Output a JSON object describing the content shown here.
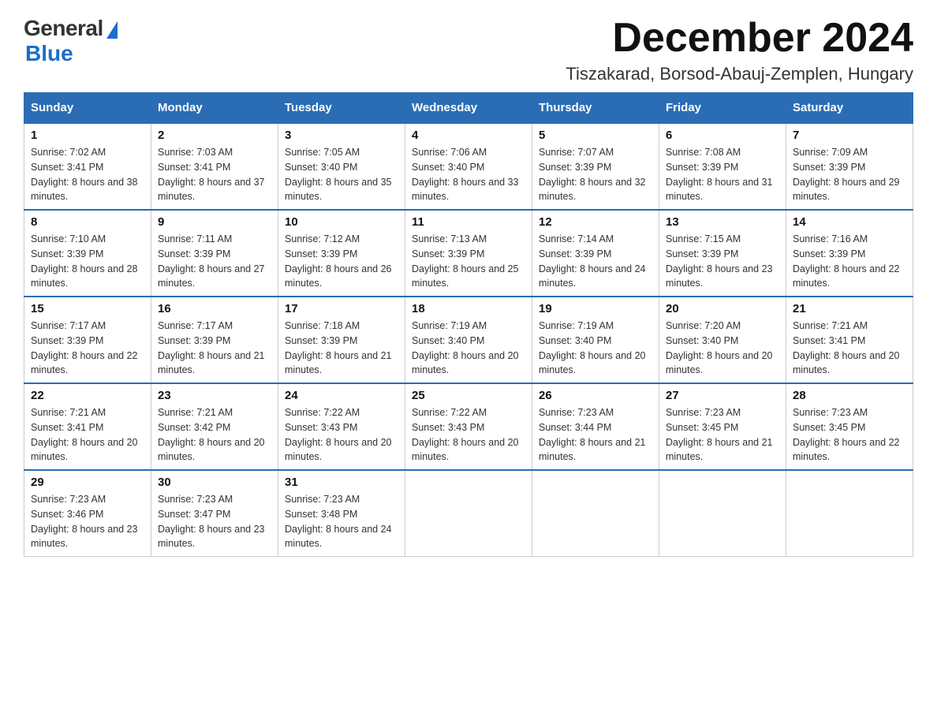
{
  "logo": {
    "general": "General",
    "blue": "Blue",
    "subtitle": "Blue"
  },
  "header": {
    "month_year": "December 2024",
    "location": "Tiszakarad, Borsod-Abauj-Zemplen, Hungary"
  },
  "days_of_week": [
    "Sunday",
    "Monday",
    "Tuesday",
    "Wednesday",
    "Thursday",
    "Friday",
    "Saturday"
  ],
  "weeks": [
    [
      {
        "day": "1",
        "sunrise": "7:02 AM",
        "sunset": "3:41 PM",
        "daylight": "8 hours and 38 minutes."
      },
      {
        "day": "2",
        "sunrise": "7:03 AM",
        "sunset": "3:41 PM",
        "daylight": "8 hours and 37 minutes."
      },
      {
        "day": "3",
        "sunrise": "7:05 AM",
        "sunset": "3:40 PM",
        "daylight": "8 hours and 35 minutes."
      },
      {
        "day": "4",
        "sunrise": "7:06 AM",
        "sunset": "3:40 PM",
        "daylight": "8 hours and 33 minutes."
      },
      {
        "day": "5",
        "sunrise": "7:07 AM",
        "sunset": "3:39 PM",
        "daylight": "8 hours and 32 minutes."
      },
      {
        "day": "6",
        "sunrise": "7:08 AM",
        "sunset": "3:39 PM",
        "daylight": "8 hours and 31 minutes."
      },
      {
        "day": "7",
        "sunrise": "7:09 AM",
        "sunset": "3:39 PM",
        "daylight": "8 hours and 29 minutes."
      }
    ],
    [
      {
        "day": "8",
        "sunrise": "7:10 AM",
        "sunset": "3:39 PM",
        "daylight": "8 hours and 28 minutes."
      },
      {
        "day": "9",
        "sunrise": "7:11 AM",
        "sunset": "3:39 PM",
        "daylight": "8 hours and 27 minutes."
      },
      {
        "day": "10",
        "sunrise": "7:12 AM",
        "sunset": "3:39 PM",
        "daylight": "8 hours and 26 minutes."
      },
      {
        "day": "11",
        "sunrise": "7:13 AM",
        "sunset": "3:39 PM",
        "daylight": "8 hours and 25 minutes."
      },
      {
        "day": "12",
        "sunrise": "7:14 AM",
        "sunset": "3:39 PM",
        "daylight": "8 hours and 24 minutes."
      },
      {
        "day": "13",
        "sunrise": "7:15 AM",
        "sunset": "3:39 PM",
        "daylight": "8 hours and 23 minutes."
      },
      {
        "day": "14",
        "sunrise": "7:16 AM",
        "sunset": "3:39 PM",
        "daylight": "8 hours and 22 minutes."
      }
    ],
    [
      {
        "day": "15",
        "sunrise": "7:17 AM",
        "sunset": "3:39 PM",
        "daylight": "8 hours and 22 minutes."
      },
      {
        "day": "16",
        "sunrise": "7:17 AM",
        "sunset": "3:39 PM",
        "daylight": "8 hours and 21 minutes."
      },
      {
        "day": "17",
        "sunrise": "7:18 AM",
        "sunset": "3:39 PM",
        "daylight": "8 hours and 21 minutes."
      },
      {
        "day": "18",
        "sunrise": "7:19 AM",
        "sunset": "3:40 PM",
        "daylight": "8 hours and 20 minutes."
      },
      {
        "day": "19",
        "sunrise": "7:19 AM",
        "sunset": "3:40 PM",
        "daylight": "8 hours and 20 minutes."
      },
      {
        "day": "20",
        "sunrise": "7:20 AM",
        "sunset": "3:40 PM",
        "daylight": "8 hours and 20 minutes."
      },
      {
        "day": "21",
        "sunrise": "7:21 AM",
        "sunset": "3:41 PM",
        "daylight": "8 hours and 20 minutes."
      }
    ],
    [
      {
        "day": "22",
        "sunrise": "7:21 AM",
        "sunset": "3:41 PM",
        "daylight": "8 hours and 20 minutes."
      },
      {
        "day": "23",
        "sunrise": "7:21 AM",
        "sunset": "3:42 PM",
        "daylight": "8 hours and 20 minutes."
      },
      {
        "day": "24",
        "sunrise": "7:22 AM",
        "sunset": "3:43 PM",
        "daylight": "8 hours and 20 minutes."
      },
      {
        "day": "25",
        "sunrise": "7:22 AM",
        "sunset": "3:43 PM",
        "daylight": "8 hours and 20 minutes."
      },
      {
        "day": "26",
        "sunrise": "7:23 AM",
        "sunset": "3:44 PM",
        "daylight": "8 hours and 21 minutes."
      },
      {
        "day": "27",
        "sunrise": "7:23 AM",
        "sunset": "3:45 PM",
        "daylight": "8 hours and 21 minutes."
      },
      {
        "day": "28",
        "sunrise": "7:23 AM",
        "sunset": "3:45 PM",
        "daylight": "8 hours and 22 minutes."
      }
    ],
    [
      {
        "day": "29",
        "sunrise": "7:23 AM",
        "sunset": "3:46 PM",
        "daylight": "8 hours and 23 minutes."
      },
      {
        "day": "30",
        "sunrise": "7:23 AM",
        "sunset": "3:47 PM",
        "daylight": "8 hours and 23 minutes."
      },
      {
        "day": "31",
        "sunrise": "7:23 AM",
        "sunset": "3:48 PM",
        "daylight": "8 hours and 24 minutes."
      },
      null,
      null,
      null,
      null
    ]
  ]
}
